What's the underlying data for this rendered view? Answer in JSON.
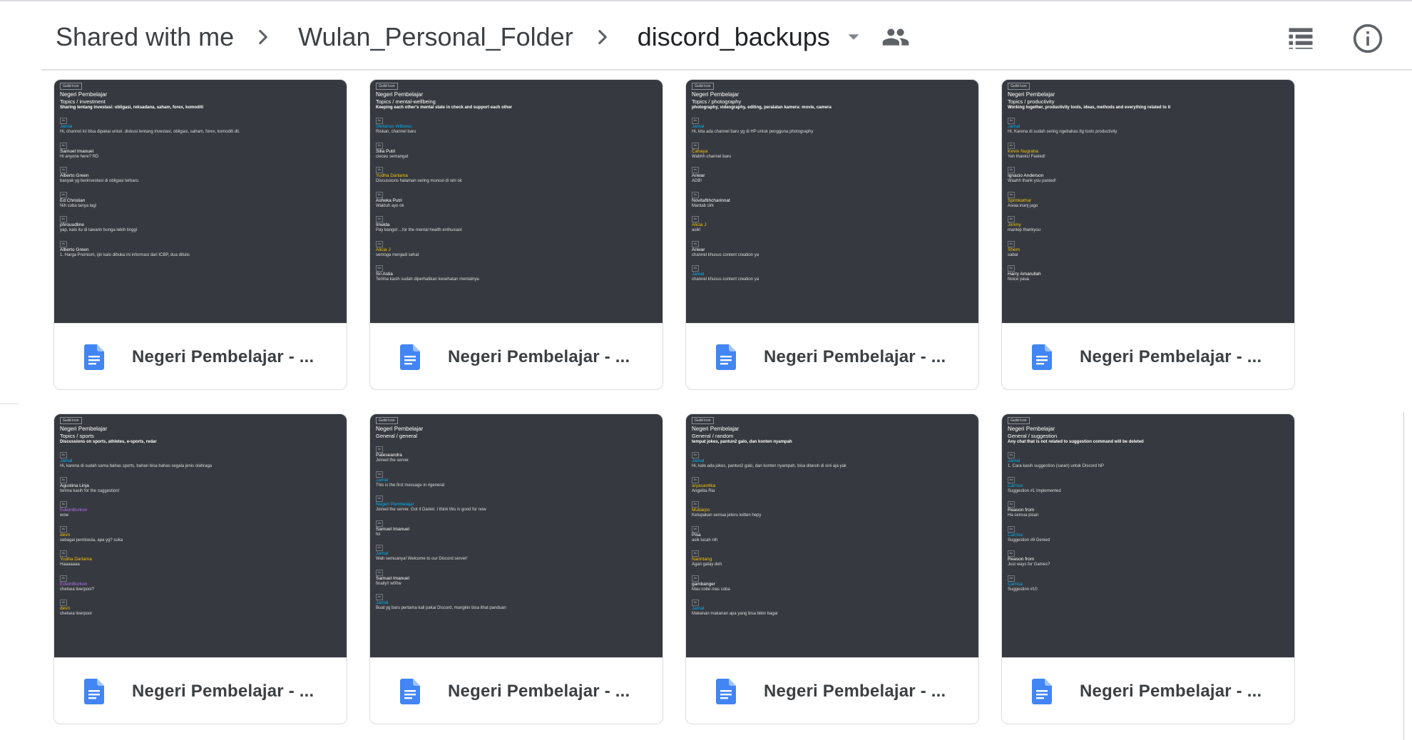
{
  "breadcrumb": {
    "items": [
      "Shared with me",
      "Wulan_Personal_Folder",
      "discord_backups"
    ]
  },
  "icons": {
    "separator": "chevron-right-icon",
    "dropdown": "caret-down-icon",
    "shared": "people-icon",
    "list_view": "list-view-icon",
    "details": "info-icon",
    "doc": "google-docs-icon"
  },
  "colors": {
    "doc_blue": "#4285f4",
    "thumb_bg": "#36393f"
  },
  "files": [
    {
      "title": "Negeri Pembelajar - ...",
      "preview": {
        "guild": "Guild Icon",
        "server": "Negeri Pembelajar",
        "channel": "Topics / investment",
        "topic": "Sharing tentang investasi: obligasi, reksadana, saham, forex, komoditi",
        "messages": [
          {
            "author": "Jamal",
            "color": "blue",
            "text": "Hi, channel ini bisa dipakai untuk: diskusi tentang investasi, obligasi, saham, forex, komoditi dll."
          },
          {
            "author": "Samuel Imanuel",
            "color": "white",
            "text": "Hi anyone here? RD"
          },
          {
            "author": "Alberto Green",
            "color": "white",
            "text": "banyak yg berinvestasi di obligasi terbaru"
          },
          {
            "author": "Ed Christian",
            "color": "white",
            "text": "Nih coba tanya lagi"
          },
          {
            "author": "phrouudline",
            "color": "white",
            "text": "yap, kalo itu di tawarin bunga lebih tinggi"
          },
          {
            "author": "Alberto Green",
            "color": "white",
            "text": "1. Harga Premium, ijin kalo dibuka ini informasi dari ICBP, dua ditulis"
          }
        ]
      }
    },
    {
      "title": "Negeri Pembelajar - ...",
      "preview": {
        "guild": "Guild Icon",
        "server": "Negeri Pembelajar",
        "channel": "Topics / mental-wellbeing",
        "topic": "Keeping each other's mental state in check and support each other",
        "messages": [
          {
            "author": "Stefanus Wibowo",
            "color": "blue",
            "text": "Riskan, channel baru"
          },
          {
            "author": "Silia Putri",
            "color": "white",
            "text": "cieceu semangat"
          },
          {
            "author": "Yudha Darlama",
            "color": "gold",
            "text": "Discussions halaman sering muncul di sini ok"
          },
          {
            "author": "Asheka Putri",
            "color": "white",
            "text": "Waktuh ayo ok"
          },
          {
            "author": "Imelda",
            "color": "white",
            "text": "Pay banget ...for the mental health enthusiast"
          },
          {
            "author": "Alicia J",
            "color": "gold",
            "text": "semoga menjadi sehat"
          },
          {
            "author": "Sri Astia",
            "color": "white",
            "text": "Terima kasih sudah diperhatikan kesehatan mentalnya"
          }
        ]
      }
    },
    {
      "title": "Negeri Pembelajar - ...",
      "preview": {
        "guild": "Guild Icon",
        "server": "Negeri Pembelajar",
        "channel": "Topics / photography",
        "topic": "photography, videography, editing, peralatan kamera: movie, camera",
        "messages": [
          {
            "author": "Jamal",
            "color": "blue",
            "text": "Hi, kita ada channel baru yg di HP untuk pengguna photography"
          },
          {
            "author": "Cahaya",
            "color": "gold",
            "text": "Wahhh channel baru"
          },
          {
            "author": "Anwar",
            "color": "white",
            "text": "ADB!"
          },
          {
            "author": "Novitaftihcharinnat",
            "color": "white",
            "text": "Mantab slrk"
          },
          {
            "author": "Alicia J",
            "color": "gold",
            "text": "asik!"
          },
          {
            "author": "Anwar",
            "color": "white",
            "text": "channel khusus content creation ya"
          },
          {
            "author": "Jamal",
            "color": "blue",
            "text": "channel khusus content creation ya"
          }
        ]
      }
    },
    {
      "title": "Negeri Pembelajar - ...",
      "preview": {
        "guild": "Guild Icon",
        "server": "Negeri Pembelajar",
        "channel": "Topics / productivity",
        "topic": "Working together, productivity tools, ideas, methods and everything related to it",
        "messages": [
          {
            "author": "Jamal",
            "color": "blue",
            "text": "Hi, Karena di sudah sering ngebahas ttg tools productivity"
          },
          {
            "author": "Kevin Nugraha",
            "color": "gold",
            "text": "Yeh thanks! Feeled!"
          },
          {
            "author": "Ignacio Anderson",
            "color": "white",
            "text": "Waahh thank you pasted!"
          },
          {
            "author": "Sprinkathar",
            "color": "gold",
            "text": "Asiaa inanj jago"
          },
          {
            "author": "Jimmy",
            "color": "gold",
            "text": "mantep thankyou"
          },
          {
            "author": "Shem",
            "color": "gold",
            "text": "sabar"
          },
          {
            "author": "Harry Amarullah",
            "color": "white",
            "text": "Noice yaua"
          }
        ]
      }
    },
    {
      "title": "Negeri Pembelajar - ...",
      "preview": {
        "guild": "Guild Icon",
        "server": "Negeri Pembelajar",
        "channel": "Topics / sports",
        "topic": "Discussions on sports, athletes, e-sports, redar",
        "messages": [
          {
            "author": "Jamal",
            "color": "blue",
            "text": "Hi, karena di sudah sama bahas sports, bahan bisa bahas segala jenis olahraga"
          },
          {
            "author": "Agustina Linja",
            "color": "white",
            "text": "terima kasih for the suggestion!"
          },
          {
            "author": "EdwinBurkon",
            "color": "purple",
            "text": "wow"
          },
          {
            "author": "devri",
            "color": "gold",
            "text": "sebagai pemboula, apa yg? suka"
          },
          {
            "author": "Yudha Darlama",
            "color": "gold",
            "text": "Haaaaaaa"
          },
          {
            "author": "EdwinBurkon",
            "color": "purple",
            "text": "chelsea liverpool?"
          },
          {
            "author": "devri",
            "color": "gold",
            "text": "chelsea liverpool"
          }
        ]
      }
    },
    {
      "title": "Negeri Pembelajar - ...",
      "preview": {
        "guild": "Guild Icon",
        "server": "Negeri Pembelajar",
        "channel": "General / general",
        "topic": "",
        "messages": [
          {
            "author": "Pateseandra",
            "color": "white",
            "text": "Joined the server."
          },
          {
            "author": "Jamal",
            "color": "blue",
            "text": "This is the first message in #general"
          },
          {
            "author": "Negeri Pembelajar",
            "color": "blue",
            "text": "Joined the server. Got it Daniel. I think this is good for now"
          },
          {
            "author": "Samuel Imanuel",
            "color": "white",
            "text": "hii"
          },
          {
            "author": "Jamal",
            "color": "blue",
            "text": "Wah semuanya! Welcome to our Discord server!"
          },
          {
            "author": "Samuel Imanuel",
            "color": "white",
            "text": "finally!! w00w"
          },
          {
            "author": "Jamal",
            "color": "blue",
            "text": "Buat yg baru pertama kali pakai Discord, mungkin bisa lihat panduan"
          }
        ]
      }
    },
    {
      "title": "Negeri Pembelajar - ...",
      "preview": {
        "guild": "Guild Icon",
        "server": "Negeri Pembelajar",
        "channel": "General / random",
        "topic": "tempat jokes, pantun2 galo, dan konten nyampah",
        "messages": [
          {
            "author": "Jamal",
            "color": "blue",
            "text": "Hi, kalo ada jokes, pantun2 galo, dan konten nyampah, bisa ditaruh di sini aja yak"
          },
          {
            "author": "aryasantika",
            "color": "gold",
            "text": "Angelita Ria"
          },
          {
            "author": "Mutiarpo",
            "color": "gold",
            "text": "Ketupakan semua jeteru loitten hepy"
          },
          {
            "author": "Pisa",
            "color": "white",
            "text": "asik lucah nih"
          },
          {
            "author": "Narintang",
            "color": "gold",
            "text": "Agan gatay deh"
          },
          {
            "author": "gambanger",
            "color": "white",
            "text": "Mau cobe nias coba"
          },
          {
            "author": "Jamal",
            "color": "blue",
            "text": "Makanan makanan apa yang bisa bikin bagai"
          }
        ]
      }
    },
    {
      "title": "Negeri Pembelajar - ...",
      "preview": {
        "guild": "Guild Icon",
        "server": "Negeri Pembelajar",
        "channel": "General / suggestion",
        "topic": "Any chat that is not related to suggestion command will be deleted",
        "messages": [
          {
            "author": "Jamal",
            "color": "blue",
            "text": "1. Cara kasih suggestion (saran) untuk Discord NP"
          },
          {
            "author": "Carrisa",
            "color": "blue",
            "text": "Suggestion #1 Implemented"
          },
          {
            "author": "Reason from",
            "color": "white",
            "text": "Ha semua pisan"
          },
          {
            "author": "Carrisa",
            "color": "blue",
            "text": "Suggestion #8 Denied"
          },
          {
            "author": "Reason from",
            "color": "white",
            "text": "Just ways for Games?"
          },
          {
            "author": "Carrisa",
            "color": "blue",
            "text": "Suggestion #10"
          }
        ]
      }
    }
  ]
}
